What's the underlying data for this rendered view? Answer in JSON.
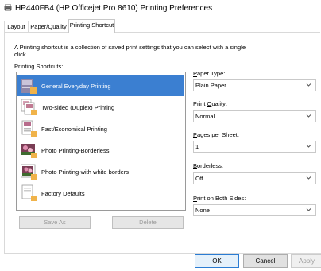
{
  "window": {
    "title": "HP440FB4 (HP Officejet Pro 8610) Printing Preferences"
  },
  "tabs": [
    {
      "label": "Layout",
      "active": false
    },
    {
      "label": "Paper/Quality",
      "active": false
    },
    {
      "label": "Printing Shortcut",
      "active": true
    }
  ],
  "panel": {
    "description": "A Printing shortcut is a collection of saved print settings that you can select with a single click.",
    "shortcuts_label": "Printing Shortcuts:",
    "shortcuts": [
      {
        "label": "General Everyday Printing",
        "icon": "general-printing-icon",
        "selected": true
      },
      {
        "label": "Two-sided (Duplex) Printing",
        "icon": "duplex-printing-icon",
        "selected": false
      },
      {
        "label": "Fast/Economical Printing",
        "icon": "fast-printing-icon",
        "selected": false
      },
      {
        "label": "Photo Printing-Borderless",
        "icon": "photo-borderless-icon",
        "selected": false
      },
      {
        "label": "Photo Printing-with white borders",
        "icon": "photo-borders-icon",
        "selected": false
      },
      {
        "label": "Factory Defaults",
        "icon": "factory-defaults-icon",
        "selected": false
      }
    ],
    "save_as_label": "Save As",
    "delete_label": "Delete"
  },
  "settings": {
    "paper_type": {
      "label_accel": "P",
      "label_rest": "aper Type:",
      "value": "Plain Paper"
    },
    "print_quality": {
      "label_pre": "Print ",
      "label_accel": "Q",
      "label_rest": "uality:",
      "value": "Normal"
    },
    "pages_per_sheet": {
      "label_accel": "P",
      "label_rest": "ages per Sheet:",
      "value": "1"
    },
    "borderless": {
      "label_accel": "B",
      "label_rest": "orderless:",
      "value": "Off"
    },
    "both_sides": {
      "label_accel": "P",
      "label_rest": "rint on Both Sides:",
      "value": "None"
    }
  },
  "footer": {
    "ok_label": "OK",
    "cancel_label": "Cancel",
    "apply_label": "Apply"
  },
  "colors": {
    "selection": "#3b7fd1",
    "disabled_text": "#9a9a9a"
  }
}
